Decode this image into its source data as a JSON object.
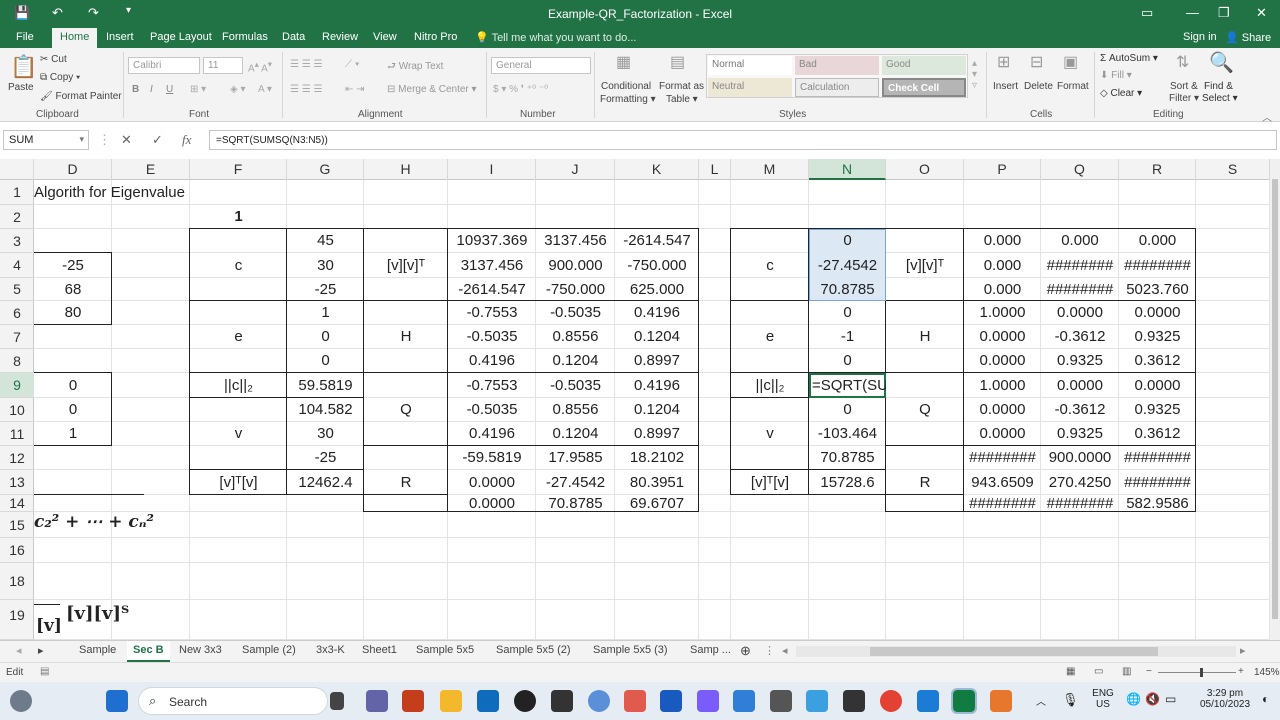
{
  "window": {
    "title": "Example-QR_Factorization - Excel"
  },
  "menu": {
    "tabs": [
      "File",
      "Home",
      "Insert",
      "Page Layout",
      "Formulas",
      "Data",
      "Review",
      "View",
      "Nitro Pro"
    ],
    "tell_me": "Tell me what you want to do...",
    "sign_in": "Sign in",
    "share": "Share"
  },
  "ribbon": {
    "paste": "Paste",
    "cut": "Cut",
    "copy": "Copy",
    "format_painter": "Format Painter",
    "clipboard": "Clipboard",
    "font_name": "Calibri",
    "font_size": "11",
    "font": "Font",
    "wrap_text": "Wrap Text",
    "merge_center": "Merge & Center",
    "alignment": "Alignment",
    "number_format": "General",
    "number": "Number",
    "conditional": "Conditional",
    "formatting": "Formatting",
    "format_as": "Format as",
    "table": "Table",
    "style_names": [
      "Normal",
      "Bad",
      "Good",
      "Neutral",
      "Calculation",
      "Check Cell"
    ],
    "styles": "Styles",
    "insert": "Insert",
    "delete": "Delete",
    "format": "Format",
    "cells": "Cells",
    "autosum": "AutoSum",
    "fill": "Fill",
    "clear": "Clear",
    "sort_filter": "Sort &",
    "filter": "Filter",
    "find_select": "Find &",
    "select": "Select",
    "editing": "Editing"
  },
  "formula_bar": {
    "name_box": "SUM",
    "cancel": "✕",
    "enter": "✓",
    "fx": "fx",
    "formula": "=SQRT(SUMSQ(N3:N5))"
  },
  "columns": [
    "D",
    "E",
    "F",
    "G",
    "H",
    "I",
    "J",
    "K",
    "L",
    "M",
    "N",
    "O",
    "P",
    "Q",
    "R",
    "S"
  ],
  "selected_column": "N",
  "rows": [
    "1",
    "2",
    "3",
    "4",
    "5",
    "6",
    "7",
    "8",
    "9",
    "10",
    "11",
    "12",
    "13",
    "14",
    "15",
    "16",
    "18",
    "19"
  ],
  "selected_row": "9",
  "cells": {
    "title": "Algorith for Eigenvalue",
    "g2": "1",
    "d4": "-25",
    "d5": "68",
    "d6": "80",
    "d9": "0",
    "d10": "0",
    "d11": "1",
    "frag14": "c₂² + ⋯ + cₙ²",
    "frag19a": "[v]",
    "frag19b": "[v][v]ᵀ",
    "g": [
      "45",
      "30",
      "-25",
      "1",
      "0",
      "0",
      "59.5819",
      "104.582",
      "30",
      "-25",
      "12462.4"
    ],
    "f_c": "c",
    "f_e": "e",
    "f_norm": "||c||₂",
    "f_v": "v",
    "f_vtv": "[v]ᵀ[v]",
    "h_vvt": "[v][v]ᵀ",
    "h_H": "H",
    "h_Q": "Q",
    "h_R": "R",
    "ijk": [
      [
        "10937.369",
        "3137.456",
        "-2614.547"
      ],
      [
        "3137.456",
        "900.000",
        "-750.000"
      ],
      [
        "-2614.547",
        "-750.000",
        "625.000"
      ],
      [
        "-0.7553",
        "-0.5035",
        "0.4196"
      ],
      [
        "-0.5035",
        "0.8556",
        "0.1204"
      ],
      [
        "0.4196",
        "0.1204",
        "0.8997"
      ],
      [
        "-0.7553",
        "-0.5035",
        "0.4196"
      ],
      [
        "-0.5035",
        "0.8556",
        "0.1204"
      ],
      [
        "0.4196",
        "0.1204",
        "0.8997"
      ],
      [
        "-59.5819",
        "17.9585",
        "18.2102"
      ],
      [
        "0.0000",
        "-27.4542",
        "80.3951"
      ],
      [
        "0.0000",
        "70.8785",
        "69.6707"
      ]
    ],
    "m_c": "c",
    "m_e": "e",
    "m_norm": "||c||₂",
    "m_v": "v",
    "m_vtv": "[v]ᵀ[v]",
    "n": [
      "0",
      "-27.4542",
      "70.8785",
      "0",
      "-1",
      "0",
      "=SQRT(SU",
      "0",
      "-103.464",
      "70.8785",
      "15728.6"
    ],
    "o_vvt": "[v][v]ᵀ",
    "o_H": "H",
    "o_Q": "Q",
    "o_R": "R",
    "pqr": [
      [
        "0.000",
        "0.000",
        "0.000"
      ],
      [
        "0.000",
        "########",
        "########"
      ],
      [
        "0.000",
        "########",
        "5023.760"
      ],
      [
        "1.0000",
        "0.0000",
        "0.0000"
      ],
      [
        "0.0000",
        "-0.3612",
        "0.9325"
      ],
      [
        "0.0000",
        "0.9325",
        "0.3612"
      ],
      [
        "1.0000",
        "0.0000",
        "0.0000"
      ],
      [
        "0.0000",
        "-0.3612",
        "0.9325"
      ],
      [
        "0.0000",
        "0.9325",
        "0.3612"
      ],
      [
        "########",
        "900.0000",
        "########"
      ],
      [
        "943.6509",
        "270.4250",
        "########"
      ],
      [
        "########",
        "########",
        "582.9586"
      ]
    ]
  },
  "sheets": [
    "Sample",
    "Sec B",
    "New 3x3",
    "Sample (2)",
    "3x3-K",
    "Sheet1",
    "Sample 5x5",
    "Sample 5x5 (2)",
    "Sample 5x5 (3)",
    "Samp ..."
  ],
  "active_sheet": "Sec B",
  "status": {
    "mode": "Edit",
    "zoom": "145%"
  },
  "taskbar": {
    "search": "Search",
    "lang1": "ENG",
    "lang2": "US",
    "time": "3:29 pm",
    "date": "05/10/2023"
  }
}
